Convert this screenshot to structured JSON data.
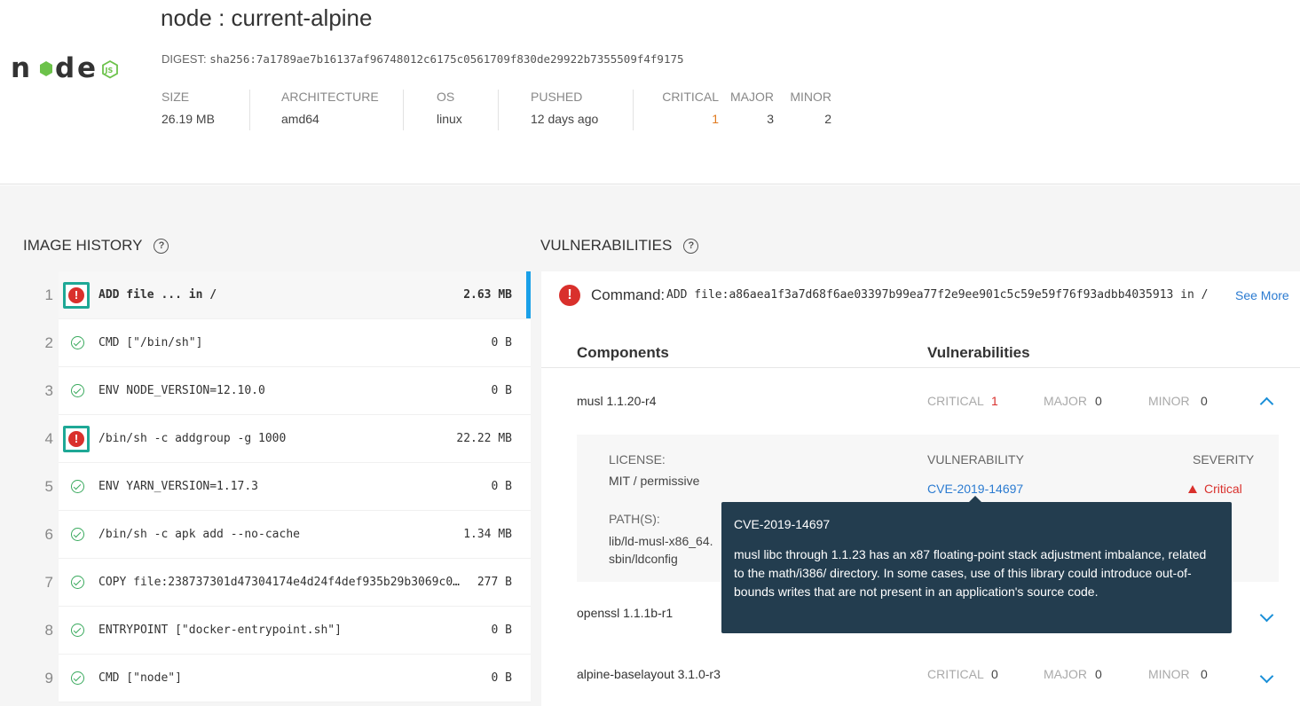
{
  "header": {
    "title": "node : current-alpine",
    "digest_label": "DIGEST:",
    "digest_value": "sha256:7a1789ae7b16137af96748012c6175c0561709f830de29922b7355509f4f9175",
    "logo_text": "node",
    "meta": [
      {
        "label": "SIZE",
        "value": "26.19 MB"
      },
      {
        "label": "ARCHITECTURE",
        "value": "amd64"
      },
      {
        "label": "OS",
        "value": "linux"
      },
      {
        "label": "PUSHED",
        "value": "12 days ago"
      }
    ],
    "counts": {
      "critical_label": "CRITICAL",
      "critical": "1",
      "major_label": "MAJOR",
      "major": "3",
      "minor_label": "MINOR",
      "minor": "2"
    }
  },
  "image_history": {
    "title": "IMAGE HISTORY",
    "help_icon": "question-circle-icon",
    "rows": [
      {
        "num": "1",
        "status": "error",
        "command": "ADD file ... in /",
        "size": "2.63 MB",
        "selected": true
      },
      {
        "num": "2",
        "status": "ok",
        "command": "CMD [\"/bin/sh\"]",
        "size": "0 B"
      },
      {
        "num": "3",
        "status": "ok",
        "command": "ENV NODE_VERSION=12.10.0",
        "size": "0 B"
      },
      {
        "num": "4",
        "status": "error",
        "command": "/bin/sh -c addgroup -g 1000",
        "size": "22.22 MB"
      },
      {
        "num": "5",
        "status": "ok",
        "command": "ENV YARN_VERSION=1.17.3",
        "size": "0 B"
      },
      {
        "num": "6",
        "status": "ok",
        "command": "/bin/sh -c apk add --no-cache",
        "size": "1.34 MB"
      },
      {
        "num": "7",
        "status": "ok",
        "command": "COPY file:238737301d47304174e4d24f4def935b29b3069c0…",
        "size": "277 B"
      },
      {
        "num": "8",
        "status": "ok",
        "command": "ENTRYPOINT [\"docker-entrypoint.sh\"]",
        "size": "0 B"
      },
      {
        "num": "9",
        "status": "ok",
        "command": "CMD [\"node\"]",
        "size": "0 B"
      }
    ]
  },
  "vulnerabilities": {
    "title": "VULNERABILITIES",
    "help_icon": "question-circle-icon",
    "command_label": "Command:",
    "command_text": "ADD file:a86aea1f3a7d68f6ae03397b99ea77f2e9ee901c5c59e59f76f93adbb4035913 in /",
    "see_more": "See More",
    "col_components": "Components",
    "col_vulnerabilities": "Vulnerabilities",
    "components": [
      {
        "name": "musl 1.1.20-r4",
        "critical": "1",
        "major": "0",
        "minor": "0",
        "expanded": true
      },
      {
        "name": "openssl 1.1.1b-r1",
        "critical": "",
        "major": "",
        "minor": "",
        "expanded": false
      },
      {
        "name": "alpine-baselayout 3.1.0-r3",
        "critical": "0",
        "major": "0",
        "minor": "0",
        "expanded": false
      }
    ],
    "labels": {
      "critical": "CRITICAL",
      "major": "MAJOR",
      "minor": "MINOR"
    },
    "detail": {
      "license_label": "LICENSE:",
      "license_value": "MIT / permissive",
      "paths_label": "PATH(S):",
      "path1": "lib/ld-musl-x86_64.",
      "path2": "sbin/ldconfig",
      "vuln_label": "VULNERABILITY",
      "vuln_id": "CVE-2019-14697",
      "severity_label": "SEVERITY",
      "severity_value": "Critical"
    },
    "tooltip": {
      "title": "CVE-2019-14697",
      "body": "musl libc through 1.1.23 has an x87 floating-point stack adjustment imbalance, related to the math/i386/ directory. In some cases, use of this library could introduce out-of-bounds writes that are not present in an application's source code."
    }
  },
  "colors": {
    "error": "#d9302c",
    "ok": "#3aaa5e",
    "link": "#2b7bd1",
    "highlight_box": "#1ea896",
    "selection_bar": "#1aa0e8",
    "tooltip_bg": "#233d4f",
    "critical_count": "#e07a1f"
  }
}
